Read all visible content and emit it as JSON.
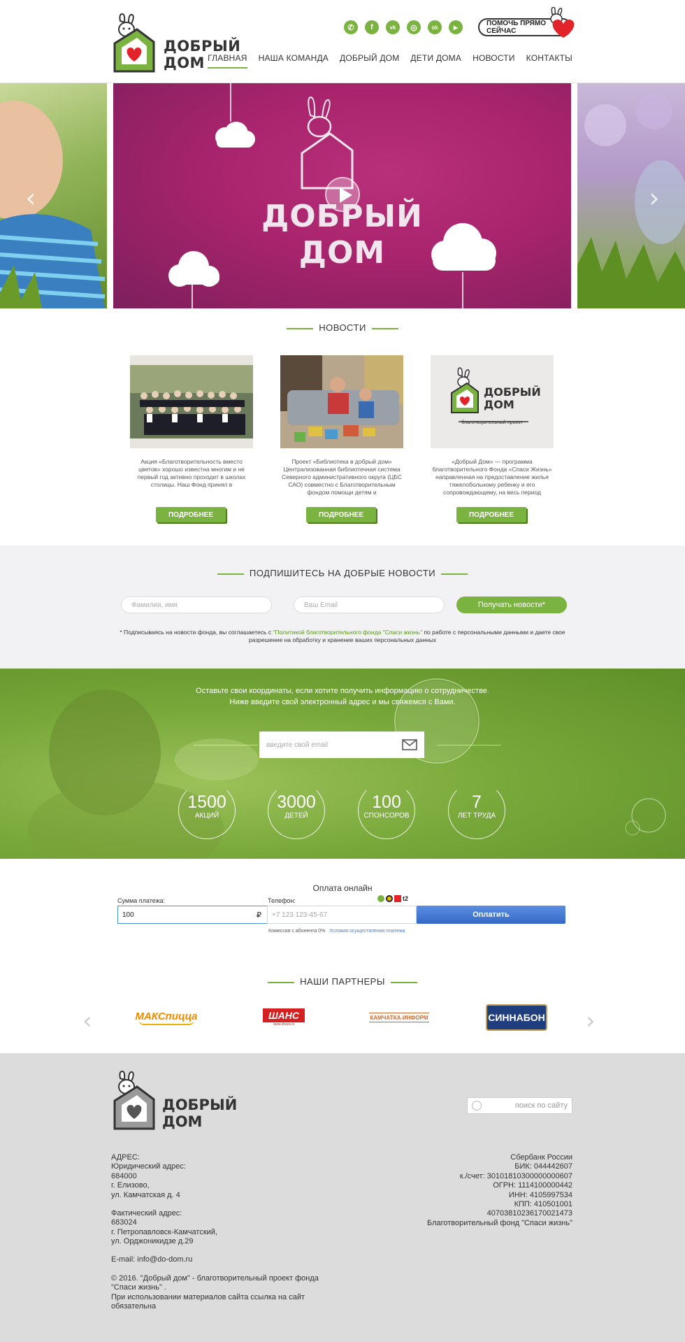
{
  "header": {
    "logo_text": [
      "ДОБРЫЙ",
      "ДОМ"
    ],
    "socials": [
      {
        "icon": "whatsapp-icon",
        "glyph": "✆"
      },
      {
        "icon": "facebook-icon",
        "glyph": "f"
      },
      {
        "icon": "vk-icon",
        "glyph": "vk"
      },
      {
        "icon": "instagram-icon",
        "glyph": "◎"
      },
      {
        "icon": "odnoklassniki-icon",
        "glyph": "ok"
      },
      {
        "icon": "youtube-icon",
        "glyph": "▶"
      }
    ],
    "help_label": "ПОМОЧЬ ПРЯМО СЕЙЧАС",
    "nav": [
      "ГЛАВНАЯ",
      "НАША КОМАНДА",
      "ДОБРЫЙ ДОМ",
      "ДЕТИ ДОМА",
      "НОВОСТИ",
      "КОНТАКТЫ"
    ],
    "nav_active": "ГЛАВНАЯ"
  },
  "slider": {
    "title": [
      "ДОБРЫЙ",
      "ДОМ"
    ],
    "prev_arrow": "‹",
    "next_arrow": "›"
  },
  "news": {
    "title": "НОВОСТИ",
    "items": [
      {
        "text": "Акция «Благотворительность вместо цветов» хорошо известна многим и не первый год активно проходит в школах столицы. Наш Фонд принял в",
        "button": "ПОДРОБНЕЕ"
      },
      {
        "text": "Проект «Библиотека в добрый дом» Централизованная библиотечная система Северного административного округа (ЦБС САО) совместно с Благотворительным фондом помощи детям и",
        "button": "ПОДРОБНЕЕ"
      },
      {
        "text": "«Добрый Дом» — программа благотворительного Фонда «Спаси Жизнь» направленная на предоставление жилья тяжелобольному ребенку и его сопровождающему, на весь период",
        "button": "ПОДРОБНЕЕ"
      }
    ],
    "logo_card_text": [
      "ДОБРЫЙ",
      "ДОМ"
    ],
    "logo_card_caption": "благотворительный проект"
  },
  "subscribe": {
    "title": "ПОДПИШИТЕСЬ НА ДОБРЫЕ НОВОСТИ",
    "name_placeholder": "Фамилия, имя",
    "email_placeholder": "Ваш Email",
    "button": "Получать новости*",
    "note_before": "* Подписываясь на новости фонда, вы соглашаетесь с ",
    "note_link": "\"Политикой благотворительного фонда \"Спаси жизнь\"",
    "note_after": " по работе с персональными данными и даете свое разрешение на обработку и хранение ваших персональных данных"
  },
  "banner": {
    "line1": "Оставьте свои координаты, если хотите получить информацию о сотрудничестве.",
    "line2": "Ниже введите свой электронный адрес и мы свяжемся с Вами.",
    "email_placeholder": "введите свой email",
    "stats": [
      {
        "num": "1500",
        "label": "АКЦИЙ"
      },
      {
        "num": "3000",
        "label": "ДЕТЕЙ"
      },
      {
        "num": "100",
        "label": "СПОНСОРОВ"
      },
      {
        "num": "7",
        "label": "ЛЕТ ТРУДА"
      }
    ]
  },
  "payment": {
    "title": "Оплата онлайн",
    "amount_label": "Сумма платежа:",
    "amount_value": "100",
    "currency": "₽",
    "phone_label": "Телефон:",
    "phone_placeholder": "+7 123 123-45-67",
    "operator_t2": "t2",
    "button": "Оплатить",
    "fee_note": "Комиссия с абонента 0%",
    "terms_link": "Условия осуществления платежа"
  },
  "partners": {
    "title": "НАШИ ПАРТНЕРЫ",
    "logos": [
      "МАКСпицца",
      "ШАНС",
      "КАМЧАТКА-ИНФОРМ",
      "СИННАБОН"
    ],
    "sub_logos": [
      "",
      "www.shans.tv",
      "",
      ""
    ],
    "prev": "‹",
    "next": "›"
  },
  "footer": {
    "logo_text": [
      "ДОБРЫЙ",
      "ДОМ"
    ],
    "search_placeholder": "поиск по сайту",
    "address_lines": [
      "АДРЕС:",
      "Юридический адрес:",
      "684000",
      "г. Елизово,",
      "ул. Камчатская д. 4"
    ],
    "fact_lines": [
      "Фактический адрес:",
      "683024",
      "г. Петропавловск-Камчатский,",
      "ул. Орджоникидзе д.29"
    ],
    "email": "E-mail: info@do-dom.ru",
    "copyright_lines": [
      "© 2016. \"Добрый дом\" - благотворительный проект фонда",
      "\"Спаси жизнь\" .",
      "При использовании материалов сайта ссылка на сайт",
      "обязательна"
    ],
    "bank_lines": [
      "Сбербанк России",
      "БИК: 044442607",
      "к./счет: 30101810300000000607",
      "ОГРН: 1114100000442",
      "ИНН: 4105997534",
      "КПП: 410501001",
      "40703810236170021473",
      "Благотворительный фонд \"Спаси жизнь\""
    ]
  },
  "colors": {
    "green": "#7ab33f",
    "magenta": "#a8246c",
    "pay_blue": "#3569c6"
  }
}
